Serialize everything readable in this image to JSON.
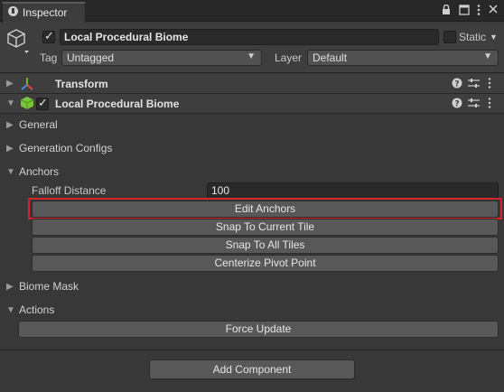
{
  "tab": {
    "title": "Inspector",
    "icons": [
      "info-icon",
      "lock-icon",
      "maximize-icon",
      "kebab-menu-icon"
    ]
  },
  "object": {
    "name": "Local Procedural Biome",
    "static_label": "Static",
    "tag_label": "Tag",
    "tag_value": "Untagged",
    "layer_label": "Layer",
    "layer_value": "Default"
  },
  "components": {
    "transform": {
      "title": "Transform"
    },
    "biome": {
      "title": "Local Procedural Biome"
    }
  },
  "sections": {
    "general": "General",
    "generation_configs": "Generation Configs",
    "anchors": "Anchors",
    "biome_mask": "Biome Mask",
    "actions": "Actions"
  },
  "anchors": {
    "falloff_label": "Falloff Distance",
    "falloff_value": "100",
    "buttons": [
      "Edit Anchors",
      "Snap To Current Tile",
      "Snap To All Tiles",
      "Centerize Pivot Point"
    ]
  },
  "actions": {
    "force_update": "Force Update"
  },
  "footer": {
    "add_component": "Add Component"
  },
  "colors": {
    "background": "#383838",
    "highlight": "#d2242a",
    "accent_icon": "#7cc43a"
  }
}
